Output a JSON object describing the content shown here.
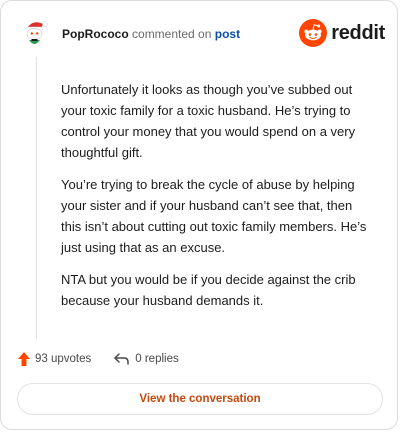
{
  "comment": {
    "username": "PopRococo",
    "commented_on_text": "commented on",
    "post_link": "post",
    "paragraphs": [
      "Unfortunately it looks as though you’ve subbed out your toxic family for a toxic husband. He’s trying to control your money that you would spend on a very thoughtful gift.",
      "You’re trying to break the cycle of abuse by helping your sister and if your husband can’t see that, then this isn’t about cutting out toxic family members. He’s just using that as an excuse.",
      "NTA but you would be if you decide against the crib because your husband demands it."
    ]
  },
  "brand": {
    "wordmark": "reddit",
    "icon": "reddit-snoo-icon",
    "color": "#ff4500"
  },
  "actions": {
    "upvotes": "93 upvotes",
    "replies": "0 replies",
    "upvote_icon": "upvote-arrow-icon",
    "reply_icon": "reply-arrow-icon",
    "upvote_color": "#ff4500"
  },
  "cta": {
    "label": "View the conversation"
  }
}
